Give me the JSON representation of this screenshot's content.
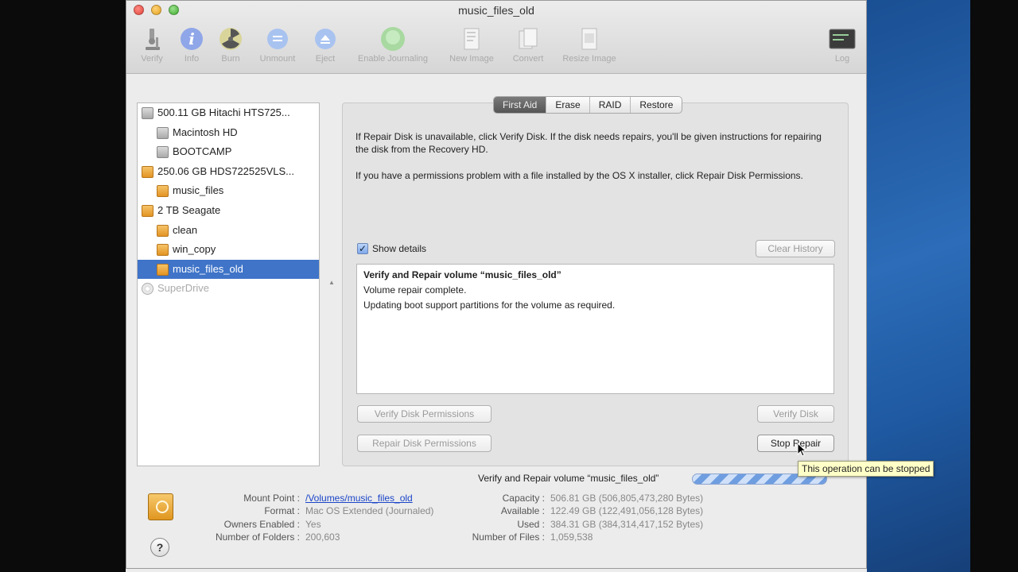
{
  "window": {
    "title": "music_files_old"
  },
  "toolbar": {
    "verify": "Verify",
    "info": "Info",
    "burn": "Burn",
    "unmount": "Unmount",
    "eject": "Eject",
    "enable_journaling": "Enable Journaling",
    "new_image": "New Image",
    "convert": "Convert",
    "resize_image": "Resize Image",
    "log": "Log",
    "log_icon_text": "WARNING\n1:36"
  },
  "sidebar": {
    "items": [
      {
        "label": "500.11 GB Hitachi HTS725...",
        "kind": "disk",
        "color": "gray"
      },
      {
        "label": "Macintosh HD",
        "kind": "volume",
        "color": "gray"
      },
      {
        "label": "BOOTCAMP",
        "kind": "volume",
        "color": "gray"
      },
      {
        "label": "250.06 GB HDS722525VLS...",
        "kind": "disk",
        "color": "orange"
      },
      {
        "label": "music_files",
        "kind": "volume",
        "color": "orange"
      },
      {
        "label": "2 TB Seagate",
        "kind": "disk",
        "color": "orange"
      },
      {
        "label": "clean",
        "kind": "volume",
        "color": "orange"
      },
      {
        "label": "win_copy",
        "kind": "volume",
        "color": "orange"
      },
      {
        "label": "music_files_old",
        "kind": "volume",
        "color": "orange",
        "selected": true
      },
      {
        "label": "SuperDrive",
        "kind": "optical",
        "color": "gray",
        "dimmed": true
      }
    ]
  },
  "tabs": [
    "First Aid",
    "Erase",
    "RAID",
    "Restore"
  ],
  "active_tab": "First Aid",
  "first_aid": {
    "info_1": "If Repair Disk is unavailable, click Verify Disk. If the disk needs repairs, you'll be given instructions for repairing the disk from the Recovery HD.",
    "info_2": "If you have a permissions problem with a file installed by the OS X installer, click Repair Disk Permissions.",
    "show_details_label": "Show details",
    "show_details_checked": true,
    "clear_history": "Clear History",
    "log_lines": [
      "Verify and Repair volume “music_files_old”",
      "Volume repair complete.",
      "Updating boot support partitions for the volume as required."
    ],
    "verify_permissions": "Verify Disk Permissions",
    "repair_permissions": "Repair Disk Permissions",
    "verify_disk": "Verify Disk",
    "stop_repair": "Stop Repair"
  },
  "status": {
    "text": "Verify and Repair volume “music_files_old”",
    "tooltip": "This operation can be stopped"
  },
  "details": {
    "mount_point_label": "Mount Point :",
    "mount_point": "/Volumes/music_files_old",
    "format_label": "Format :",
    "format": "Mac OS Extended (Journaled)",
    "owners_label": "Owners Enabled :",
    "owners": "Yes",
    "folders_label": "Number of Folders :",
    "folders": "200,603",
    "capacity_label": "Capacity :",
    "capacity": "506.81 GB (506,805,473,280 Bytes)",
    "available_label": "Available :",
    "available": "122.49 GB (122,491,056,128 Bytes)",
    "used_label": "Used :",
    "used": "384.31 GB (384,314,417,152 Bytes)",
    "files_label": "Number of Files :",
    "files": "1,059,538"
  },
  "help": "?"
}
